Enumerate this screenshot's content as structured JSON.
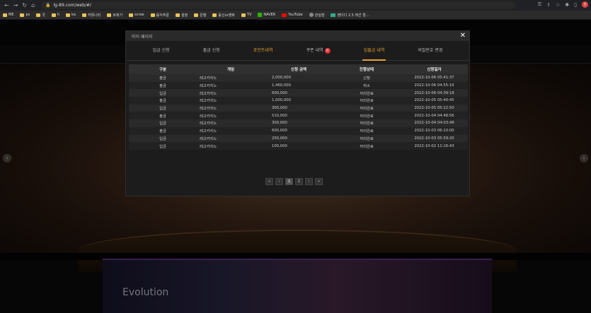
{
  "browser": {
    "url": "lg-89.com/web/#/",
    "bookmarks": [
      "ME",
      "ps",
      "국",
      "h",
      "ka",
      "커뮤니티",
      "트레기",
      "scroe",
      "음식주문",
      "설정",
      "은행",
      "동신or영화",
      "TV",
      "NAVER",
      "YouTube",
      "관실점",
      "랜더디 2.5 레선 형..."
    ],
    "avatar_letter": "Y"
  },
  "modal": {
    "title": "마이 페이지",
    "close": "✕",
    "tabs": [
      {
        "label": "입금 신청"
      },
      {
        "label": "출금 신청"
      },
      {
        "label": "포인트내역"
      },
      {
        "label": "쿠폰 내역",
        "badge": "0"
      },
      {
        "label": "입출금 내역"
      },
      {
        "label": "비밀번호 변경"
      }
    ],
    "table": {
      "headers": [
        "구분",
        "게임",
        "신청 금액",
        "진행상태",
        "신청일자"
      ],
      "rows": [
        [
          "출금",
          "레고카지노",
          "2,000,000",
          "신청",
          "2022-10-06 05:41:37"
        ],
        [
          "출금",
          "레고카지노",
          "1,460,000",
          "취소",
          "2022-10-06 04:55:16"
        ],
        [
          "입금",
          "레고카지노",
          "600,000",
          "처리완료",
          "2022-10-06 04:39:18"
        ],
        [
          "출금",
          "레고카지노",
          "1,000,000",
          "처리완료",
          "2022-10-05 05:40:45"
        ],
        [
          "입금",
          "레고카지노",
          "300,000",
          "처리완료",
          "2022-10-05 05:22:50"
        ],
        [
          "출금",
          "레고카지노",
          "510,000",
          "처리완료",
          "2022-10-04 04:48:56"
        ],
        [
          "입금",
          "레고카지노",
          "300,000",
          "처리완료",
          "2022-10-04 04:03:48"
        ],
        [
          "출금",
          "레고카지노",
          "600,000",
          "처리완료",
          "2022-10-03 06:10:00"
        ],
        [
          "입금",
          "레고카지노",
          "250,000",
          "처리완료",
          "2022-10-03 05:59:20"
        ],
        [
          "입금",
          "레고카지노",
          "100,000",
          "처리완료",
          "2022-10-02 11:16:43"
        ]
      ]
    },
    "pager": [
      "«",
      "‹",
      "1",
      "2",
      "›",
      "»"
    ],
    "pager_active": "1"
  },
  "site": {
    "promo_brand": "Evolution"
  },
  "colors": {
    "accent": "#e8a030",
    "badge": "#e03030"
  }
}
